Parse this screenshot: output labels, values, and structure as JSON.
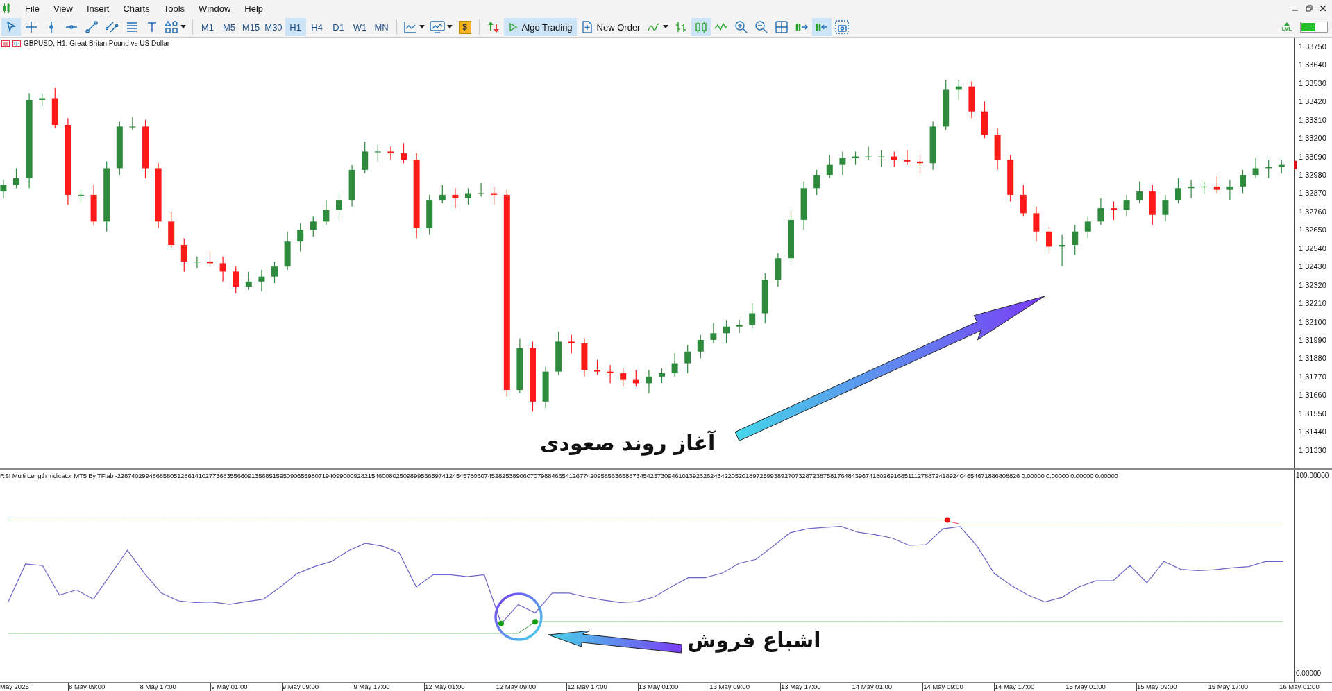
{
  "menu": [
    "File",
    "View",
    "Insert",
    "Charts",
    "Tools",
    "Window",
    "Help"
  ],
  "tools": [
    {
      "kind": "cursor",
      "selected": true
    },
    {
      "kind": "crosshair",
      "selected": false
    },
    {
      "kind": "vline",
      "selected": false
    },
    {
      "kind": "hline",
      "selected": false
    },
    {
      "kind": "trendline",
      "selected": false
    },
    {
      "kind": "channel",
      "selected": false
    },
    {
      "kind": "fibo",
      "selected": false
    },
    {
      "kind": "text",
      "selected": false
    },
    {
      "kind": "shapes",
      "selected": false
    }
  ],
  "timeframes": [
    {
      "label": "M1",
      "selected": false
    },
    {
      "label": "M5",
      "selected": false
    },
    {
      "label": "M15",
      "selected": false
    },
    {
      "label": "M30",
      "selected": false
    },
    {
      "label": "H1",
      "selected": true
    },
    {
      "label": "H4",
      "selected": false
    },
    {
      "label": "D1",
      "selected": false
    },
    {
      "label": "W1",
      "selected": false
    },
    {
      "label": "MN",
      "selected": false
    }
  ],
  "market_button": "$",
  "algo_trading": {
    "label": "Algo Trading",
    "on": true
  },
  "new_order": "New Order",
  "chart_tools": [
    {
      "kind": "signal",
      "selected": false
    },
    {
      "kind": "bars",
      "selected": false
    },
    {
      "kind": "candles",
      "selected": true
    },
    {
      "kind": "line",
      "selected": false
    },
    {
      "kind": "zoom_in",
      "selected": false
    },
    {
      "kind": "zoom_out",
      "selected": false
    },
    {
      "kind": "grid",
      "selected": false
    },
    {
      "kind": "autoscroll",
      "selected": false
    },
    {
      "kind": "shift",
      "selected": true
    },
    {
      "kind": "screenshot",
      "selected": false
    }
  ],
  "status_label": "LVL",
  "chart": {
    "title": "GBPUSD, H1:  Great Britan Pound vs US Dollar",
    "chart_data": {
      "type": "candlestick",
      "ylim": [
        1.3122,
        1.338
      ],
      "yticks": [
        {
          "value": 1.3375,
          "label": "1.33750"
        },
        {
          "value": 1.3364,
          "label": "1.33640"
        },
        {
          "value": 1.3353,
          "label": "1.33530"
        },
        {
          "value": 1.3342,
          "label": "1.33420"
        },
        {
          "value": 1.3331,
          "label": "1.33310"
        },
        {
          "value": 1.332,
          "label": "1.33200"
        },
        {
          "value": 1.3309,
          "label": "1.33090"
        },
        {
          "value": 1.3298,
          "label": "1.32980"
        },
        {
          "value": 1.3287,
          "label": "1.32870"
        },
        {
          "value": 1.3276,
          "label": "1.32760"
        },
        {
          "value": 1.3265,
          "label": "1.32650"
        },
        {
          "value": 1.3254,
          "label": "1.32540"
        },
        {
          "value": 1.3243,
          "label": "1.32430"
        },
        {
          "value": 1.3232,
          "label": "1.32320"
        },
        {
          "value": 1.3221,
          "label": "1.32210"
        },
        {
          "value": 1.321,
          "label": "1.32100"
        },
        {
          "value": 1.3199,
          "label": "1.31990"
        },
        {
          "value": 1.3188,
          "label": "1.31880"
        },
        {
          "value": 1.3177,
          "label": "1.31770"
        },
        {
          "value": 1.3166,
          "label": "1.31660"
        },
        {
          "value": 1.3155,
          "label": "1.31550"
        },
        {
          "value": 1.3144,
          "label": "1.31440"
        },
        {
          "value": 1.3133,
          "label": "1.31330"
        }
      ],
      "ohlc": [
        [
          1.3288,
          1.3295,
          1.3284,
          1.3292
        ],
        [
          1.3292,
          1.3302,
          1.329,
          1.3296
        ],
        [
          1.3296,
          1.3347,
          1.329,
          1.3343
        ],
        [
          1.3343,
          1.3347,
          1.3339,
          1.3344
        ],
        [
          1.3344,
          1.335,
          1.3326,
          1.3328
        ],
        [
          1.3328,
          1.3332,
          1.328,
          1.3286
        ],
        [
          1.3286,
          1.3289,
          1.3282,
          1.3286
        ],
        [
          1.3286,
          1.3292,
          1.3268,
          1.327
        ],
        [
          1.327,
          1.3306,
          1.3264,
          1.3302
        ],
        [
          1.3302,
          1.333,
          1.3298,
          1.3327
        ],
        [
          1.3327,
          1.3333,
          1.3325,
          1.3327
        ],
        [
          1.3327,
          1.3331,
          1.3296,
          1.3302
        ],
        [
          1.3302,
          1.3305,
          1.3266,
          1.327
        ],
        [
          1.327,
          1.3276,
          1.3254,
          1.3256
        ],
        [
          1.3256,
          1.326,
          1.324,
          1.3246
        ],
        [
          1.3246,
          1.3249,
          1.3242,
          1.3246
        ],
        [
          1.3246,
          1.3252,
          1.3243,
          1.3245
        ],
        [
          1.3245,
          1.3249,
          1.3234,
          1.324
        ],
        [
          1.324,
          1.3243,
          1.3227,
          1.3231
        ],
        [
          1.3231,
          1.324,
          1.3229,
          1.3234
        ],
        [
          1.3234,
          1.3241,
          1.3228,
          1.3237
        ],
        [
          1.3237,
          1.3246,
          1.3233,
          1.3243
        ],
        [
          1.3243,
          1.3264,
          1.3241,
          1.3258
        ],
        [
          1.3258,
          1.3269,
          1.3252,
          1.3265
        ],
        [
          1.3265,
          1.3273,
          1.3261,
          1.327
        ],
        [
          1.327,
          1.3283,
          1.3268,
          1.3277
        ],
        [
          1.3277,
          1.3287,
          1.3271,
          1.3283
        ],
        [
          1.3283,
          1.3304,
          1.3279,
          1.3301
        ],
        [
          1.3301,
          1.3318,
          1.3299,
          1.3312
        ],
        [
          1.3312,
          1.3316,
          1.3306,
          1.3312
        ],
        [
          1.3312,
          1.3315,
          1.3307,
          1.3311
        ],
        [
          1.3311,
          1.3317,
          1.3305,
          1.3307
        ],
        [
          1.3307,
          1.3311,
          1.326,
          1.3266
        ],
        [
          1.3266,
          1.3286,
          1.3262,
          1.3283
        ],
        [
          1.3283,
          1.3292,
          1.3281,
          1.3286
        ],
        [
          1.3286,
          1.329,
          1.3278,
          1.3284
        ],
        [
          1.3284,
          1.329,
          1.328,
          1.3287
        ],
        [
          1.3287,
          1.3293,
          1.3285,
          1.3287
        ],
        [
          1.3287,
          1.3291,
          1.328,
          1.3286
        ],
        [
          1.3286,
          1.3289,
          1.3165,
          1.3169
        ],
        [
          1.3169,
          1.32,
          1.3167,
          1.3194
        ],
        [
          1.3194,
          1.3198,
          1.3156,
          1.3162
        ],
        [
          1.3162,
          1.3183,
          1.3158,
          1.318
        ],
        [
          1.318,
          1.3204,
          1.3178,
          1.3198
        ],
        [
          1.3198,
          1.3202,
          1.3191,
          1.3197
        ],
        [
          1.3197,
          1.32,
          1.3177,
          1.3181
        ],
        [
          1.3181,
          1.3187,
          1.3178,
          1.318
        ],
        [
          1.318,
          1.3184,
          1.3173,
          1.3179
        ],
        [
          1.3179,
          1.3182,
          1.3171,
          1.3175
        ],
        [
          1.3175,
          1.3181,
          1.3171,
          1.3173
        ],
        [
          1.3173,
          1.3181,
          1.3167,
          1.3177
        ],
        [
          1.3177,
          1.3182,
          1.3173,
          1.3179
        ],
        [
          1.3179,
          1.3191,
          1.3177,
          1.3185
        ],
        [
          1.3185,
          1.3196,
          1.3179,
          1.3192
        ],
        [
          1.3192,
          1.3202,
          1.3188,
          1.3199
        ],
        [
          1.3199,
          1.3209,
          1.3197,
          1.3203
        ],
        [
          1.3203,
          1.3211,
          1.3197,
          1.3207
        ],
        [
          1.3207,
          1.3211,
          1.3203,
          1.3208
        ],
        [
          1.3208,
          1.3221,
          1.3206,
          1.3215
        ],
        [
          1.3215,
          1.3239,
          1.3209,
          1.3235
        ],
        [
          1.3235,
          1.3251,
          1.3231,
          1.3248
        ],
        [
          1.3248,
          1.3277,
          1.3246,
          1.3271
        ],
        [
          1.3271,
          1.3294,
          1.3265,
          1.329
        ],
        [
          1.329,
          1.3301,
          1.3286,
          1.3298
        ],
        [
          1.3298,
          1.331,
          1.3296,
          1.3304
        ],
        [
          1.3304,
          1.3312,
          1.3298,
          1.3308
        ],
        [
          1.3308,
          1.3312,
          1.3304,
          1.3309
        ],
        [
          1.3309,
          1.3315,
          1.3307,
          1.3309
        ],
        [
          1.3309,
          1.3313,
          1.3303,
          1.3309
        ],
        [
          1.3309,
          1.3312,
          1.3303,
          1.3307
        ],
        [
          1.3307,
          1.3313,
          1.3304,
          1.3306
        ],
        [
          1.3306,
          1.331,
          1.3299,
          1.3305
        ],
        [
          1.3305,
          1.333,
          1.3301,
          1.3327
        ],
        [
          1.3327,
          1.3355,
          1.3325,
          1.3349
        ],
        [
          1.3349,
          1.3355,
          1.3343,
          1.3351
        ],
        [
          1.3351,
          1.3354,
          1.3332,
          1.3336
        ],
        [
          1.3336,
          1.3342,
          1.332,
          1.3322
        ],
        [
          1.3322,
          1.3326,
          1.3301,
          1.3307
        ],
        [
          1.3307,
          1.331,
          1.3282,
          1.3286
        ],
        [
          1.3286,
          1.3292,
          1.3273,
          1.3275
        ],
        [
          1.3275,
          1.3279,
          1.3258,
          1.3264
        ],
        [
          1.3264,
          1.3267,
          1.3251,
          1.3255
        ],
        [
          1.3255,
          1.3262,
          1.3243,
          1.3256
        ],
        [
          1.3256,
          1.3268,
          1.325,
          1.3264
        ],
        [
          1.3264,
          1.3273,
          1.326,
          1.327
        ],
        [
          1.327,
          1.3284,
          1.3268,
          1.3278
        ],
        [
          1.3278,
          1.3282,
          1.3271,
          1.3277
        ],
        [
          1.3277,
          1.3286,
          1.3273,
          1.3283
        ],
        [
          1.3283,
          1.3294,
          1.3281,
          1.3288
        ],
        [
          1.3288,
          1.3292,
          1.3268,
          1.3274
        ],
        [
          1.3274,
          1.3286,
          1.327,
          1.3283
        ],
        [
          1.3283,
          1.3296,
          1.3281,
          1.329
        ],
        [
          1.329,
          1.3295,
          1.3284,
          1.3291
        ],
        [
          1.3291,
          1.3294,
          1.3287,
          1.3291
        ],
        [
          1.3291,
          1.3297,
          1.3287,
          1.3289
        ],
        [
          1.3289,
          1.3295,
          1.3283,
          1.3291
        ],
        [
          1.3291,
          1.3301,
          1.3287,
          1.3298
        ],
        [
          1.3298,
          1.3308,
          1.3296,
          1.3302
        ],
        [
          1.3302,
          1.3307,
          1.3296,
          1.3303
        ],
        [
          1.3303,
          1.3307,
          1.3299,
          1.3304
        ]
      ]
    },
    "annotation": "آغاز روند صعودی"
  },
  "indicator": {
    "label": "RSI Multi Length Indicator MT5 By TFlab -2287402994868580512861410277368355660913568515950906559807194099000928215460080250989956659741245457806074528253890607079884665412677420958563658873454237309461013926262434220520189725993892707328723875817648439674180269168511127887241892404654671886808826 0.00000 0.00000 0.00000 0.00000",
    "chart_data": {
      "type": "line",
      "ylim": [
        -4.4,
        102.8
      ],
      "yticks": [
        {
          "value": 100,
          "label": "100.00000"
        },
        {
          "value": 0,
          "label": "0.00000"
        }
      ],
      "series": [
        {
          "color": "#6a64c8",
          "values": [
            36.3,
            55.2,
            54.4,
            39.5,
            42.1,
            37.4,
            49.8,
            62.1,
            50.5,
            40.5,
            36.6,
            35.7,
            36.0,
            34.8,
            36.2,
            37.4,
            43.6,
            50.4,
            53.9,
            56.4,
            61.8,
            65.7,
            64.2,
            60.8,
            43.6,
            49.8,
            49.8,
            48.8,
            49.8,
            25.1,
            34.7,
            30.5,
            40.5,
            40.5,
            38.5,
            37.0,
            35.8,
            36.2,
            38.5,
            43.6,
            48.3,
            48.3,
            50.6,
            55.5,
            57.5,
            64.2,
            71.0,
            73.0,
            73.7,
            74.2,
            71.2,
            70.0,
            68.3,
            64.6,
            64.9,
            73.0,
            74.1,
            64.2,
            50.6,
            44.4,
            39.5,
            36.0,
            38.3,
            43.6,
            46.7,
            46.7,
            54.4,
            45.7,
            56.5,
            52.5,
            51.9,
            52.3,
            53.3,
            53.9,
            56.5,
            56.4
          ]
        },
        {
          "color": "#e05050",
          "values": [
            77.4,
            77.4,
            77.4,
            77.4,
            77.4,
            77.4,
            77.4,
            77.4,
            77.4,
            77.4,
            77.4,
            77.4,
            77.4,
            77.4,
            77.4,
            77.4,
            77.4,
            77.4,
            77.4,
            77.4,
            77.4,
            77.4,
            77.4,
            77.4,
            77.4,
            77.4,
            77.4,
            77.4,
            77.4,
            77.4,
            77.4,
            77.4,
            77.4,
            77.4,
            77.4,
            77.4,
            77.4,
            77.4,
            77.4,
            77.4,
            77.4,
            77.4,
            77.4,
            77.4,
            77.4,
            77.4,
            77.4,
            77.4,
            77.4,
            77.4,
            77.4,
            77.4,
            77.4,
            77.4,
            77.4,
            77.4,
            75.3,
            75.3,
            75.3,
            75.3,
            75.3,
            75.3,
            75.3,
            75.3,
            75.3,
            75.3,
            75.3,
            75.3,
            75.3,
            75.3,
            75.3,
            75.3,
            75.3,
            75.3,
            75.3,
            75.3
          ]
        },
        {
          "color": "#3a9a3a",
          "values": [
            20.2,
            20.2,
            20.2,
            20.2,
            20.2,
            20.2,
            20.2,
            20.2,
            20.2,
            20.2,
            20.2,
            20.2,
            20.2,
            20.2,
            20.2,
            20.2,
            20.2,
            20.2,
            20.2,
            20.2,
            20.2,
            20.2,
            20.2,
            20.2,
            20.2,
            20.2,
            20.2,
            20.2,
            20.2,
            20.2,
            20.2,
            26.0,
            26.0,
            26.0,
            26.0,
            26.0,
            26.0,
            26.0,
            26.0,
            26.0,
            26.0,
            26.0,
            26.0,
            26.0,
            26.0,
            26.0,
            26.0,
            26.0,
            26.0,
            26.0,
            26.0,
            26.0,
            26.0,
            26.0,
            26.0,
            26.0,
            26.0,
            26.0,
            26.0,
            26.0,
            26.0,
            26.0,
            26.0,
            26.0,
            26.0,
            26.0,
            26.0,
            26.0,
            26.0,
            26.0,
            26.0,
            26.0,
            26.0,
            26.0,
            26.0,
            26.0
          ]
        }
      ]
    },
    "annotation": "اشباع فروش"
  },
  "time_axis": [
    "May 2025",
    "8 May 09:00",
    "8 May 17:00",
    "9 May 01:00",
    "9 May 09:00",
    "9 May 17:00",
    "12 May 01:00",
    "12 May 09:00",
    "12 May 17:00",
    "13 May 01:00",
    "13 May 09:00",
    "13 May 17:00",
    "14 May 01:00",
    "14 May 09:00",
    "14 May 17:00",
    "15 May 01:00",
    "15 May 09:00",
    "15 May 17:00",
    "16 May 01:00"
  ]
}
